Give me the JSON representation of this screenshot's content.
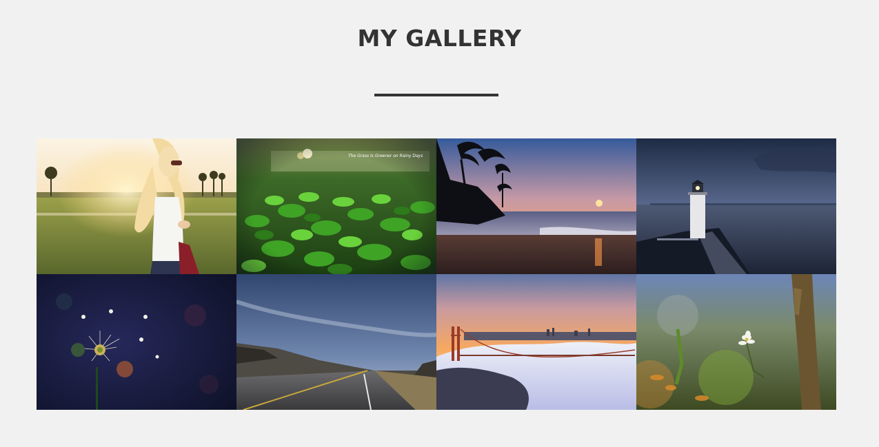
{
  "page": {
    "title": "MY GALLERY"
  },
  "gallery": {
    "items": [
      {
        "name": "gallery-photo-woman-in-field"
      },
      {
        "name": "gallery-photo-green-leaves",
        "caption": "The Grass Is Greener on Rainy Days"
      },
      {
        "name": "gallery-photo-palm-beach-sunset"
      },
      {
        "name": "gallery-photo-lighthouse"
      },
      {
        "name": "gallery-photo-dandelion"
      },
      {
        "name": "gallery-photo-highway"
      },
      {
        "name": "gallery-photo-golden-gate-fog"
      },
      {
        "name": "gallery-photo-white-flower"
      }
    ]
  },
  "colors": {
    "background": "#f1f1f1",
    "text": "#333333"
  }
}
